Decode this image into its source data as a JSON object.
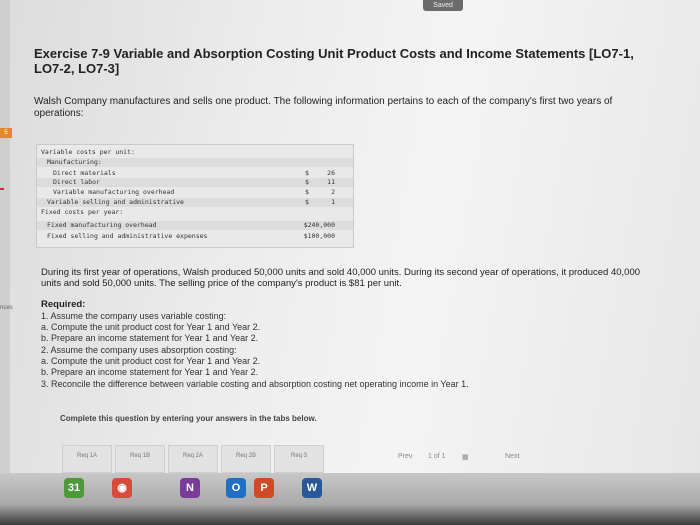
{
  "status": {
    "saved": "Saved"
  },
  "gutter": {
    "tab_top": "5",
    "tab_mid": "nces"
  },
  "exercise": {
    "title": "Exercise 7-9 Variable and Absorption Costing Unit Product Costs and Income Statements [LO7-1, LO7-2, LO7-3]",
    "intro": "Walsh Company manufactures and sells one product. The following information pertains to each of the company's first two years of operations:"
  },
  "cost_table": {
    "rows": [
      {
        "label": "Variable costs per unit:",
        "currency": "",
        "amount": "",
        "indent": 0
      },
      {
        "label": "Manufacturing:",
        "currency": "",
        "amount": "",
        "indent": 1
      },
      {
        "label": "Direct materials",
        "currency": "$",
        "amount": "26",
        "indent": 2
      },
      {
        "label": "Direct labor",
        "currency": "$",
        "amount": "11",
        "indent": 2
      },
      {
        "label": "Variable manufacturing overhead",
        "currency": "$",
        "amount": "2",
        "indent": 2
      },
      {
        "label": "Variable selling and administrative",
        "currency": "$",
        "amount": "1",
        "indent": 1
      },
      {
        "label": "Fixed costs per year:",
        "currency": "",
        "amount": "",
        "indent": 0
      },
      {
        "label": "Fixed manufacturing overhead",
        "currency": "",
        "amount": "$240,000",
        "indent": 1
      },
      {
        "label": "Fixed selling and administrative expenses",
        "currency": "",
        "amount": "$100,000",
        "indent": 1
      }
    ]
  },
  "narrative": "During its first year of operations, Walsh produced 50,000 units and sold 40,000 units. During its second year of operations, it produced 40,000 units and sold 50,000 units. The selling price of the company's product is $81 per unit.",
  "required": {
    "heading": "Required:",
    "lines": [
      "1. Assume the company uses variable costing:",
      "a. Compute the unit product cost for Year 1 and Year 2.",
      "b. Prepare an income statement for Year 1 and Year 2.",
      "2. Assume the company uses absorption costing:",
      "a. Compute the unit product cost for Year 1 and Year 2.",
      "b. Prepare an income statement for Year 1 and Year 2.",
      "3. Reconcile the difference between variable costing and absorption costing net operating income in Year 1."
    ]
  },
  "instruction": "Complete this question by entering your answers in the tabs below.",
  "tabs": [
    {
      "label": "Req 1A"
    },
    {
      "label": "Req 1B"
    },
    {
      "label": "Req 2A"
    },
    {
      "label": "Req 2B"
    },
    {
      "label": "Req 3"
    }
  ],
  "pager": {
    "prev": "Prev",
    "position": "1 of 1",
    "next": "Next"
  },
  "dock": {
    "icons": [
      {
        "name": "calendar",
        "glyph": "31",
        "color": "#4c9a3a"
      },
      {
        "name": "chrome",
        "glyph": "◉",
        "color": "#d94a3a"
      },
      {
        "name": "onenote",
        "glyph": "N",
        "color": "#7a3b9a"
      },
      {
        "name": "outlook",
        "glyph": "O",
        "color": "#1f6fc2"
      },
      {
        "name": "powerpoint",
        "glyph": "P",
        "color": "#cf4a26"
      },
      {
        "name": "word",
        "glyph": "W",
        "color": "#2b5797"
      }
    ]
  }
}
